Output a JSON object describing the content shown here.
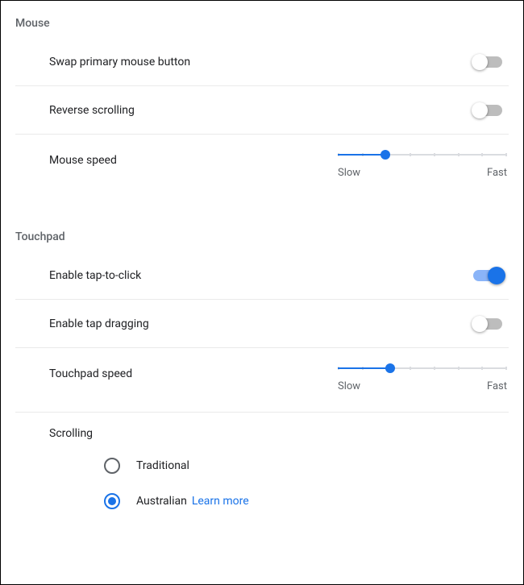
{
  "mouse": {
    "title": "Mouse",
    "swap_primary": {
      "label": "Swap primary mouse button",
      "enabled": false
    },
    "reverse_scrolling": {
      "label": "Reverse scrolling",
      "enabled": false
    },
    "speed": {
      "label": "Mouse speed",
      "min_label": "Slow",
      "max_label": "Fast",
      "value_percent": 28
    }
  },
  "touchpad": {
    "title": "Touchpad",
    "tap_to_click": {
      "label": "Enable tap-to-click",
      "enabled": true
    },
    "tap_dragging": {
      "label": "Enable tap dragging",
      "enabled": false
    },
    "speed": {
      "label": "Touchpad speed",
      "min_label": "Slow",
      "max_label": "Fast",
      "value_percent": 31
    },
    "scrolling": {
      "label": "Scrolling",
      "options": {
        "traditional": {
          "label": "Traditional",
          "selected": false
        },
        "australian": {
          "label": "Australian",
          "selected": true,
          "learn_more": "Learn more"
        }
      }
    }
  }
}
